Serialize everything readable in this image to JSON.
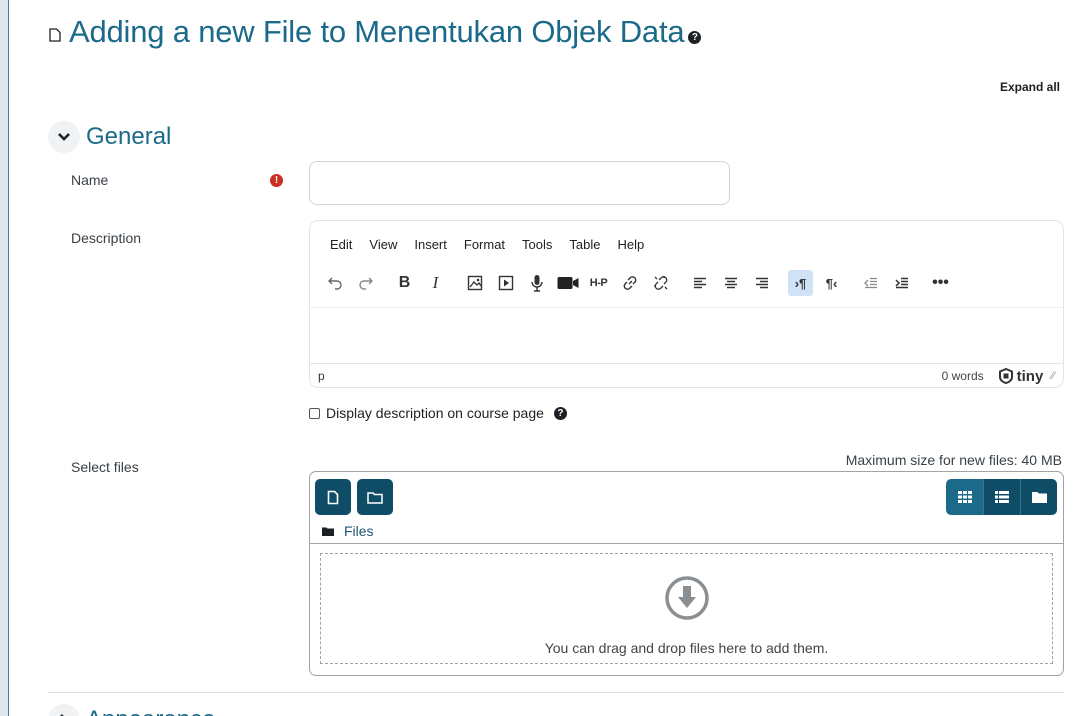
{
  "page": {
    "title": "Adding a new File to Menentukan Objek Data",
    "title_help_glyph": "?",
    "expand_all": "Expand all"
  },
  "general": {
    "section_title": "General",
    "name_label": "Name",
    "name_value": "",
    "required_glyph": "!",
    "description_label": "Description"
  },
  "editor": {
    "menu": [
      "Edit",
      "View",
      "Insert",
      "Format",
      "Tools",
      "Table",
      "Help"
    ],
    "status_path": "p",
    "word_count": "0 words",
    "brand": "tiny",
    "toolbar_icons": [
      "undo-icon",
      "redo-icon",
      "bold-icon",
      "italic-icon",
      "image-icon",
      "media-icon",
      "record-audio-icon",
      "record-video-icon",
      "h5p-icon",
      "link-icon",
      "unlink-icon",
      "align-left-icon",
      "align-center-icon",
      "align-right-icon",
      "ltr-icon",
      "rtl-icon",
      "outdent-icon",
      "indent-icon",
      "more-icon"
    ]
  },
  "display_description": {
    "label": "Display description on course page",
    "checked": false
  },
  "files": {
    "label": "Select files",
    "max_size": "Maximum size for new files: 40 MB",
    "path_label": "Files",
    "drop_text": "You can drag and drop files here to add them."
  },
  "appearance": {
    "section_title": "Appearance"
  },
  "colors": {
    "accent": "#1b6a8a",
    "button_dark": "#0f4c65",
    "required": "#ca3120",
    "active_tool": "#cfe2f7"
  }
}
